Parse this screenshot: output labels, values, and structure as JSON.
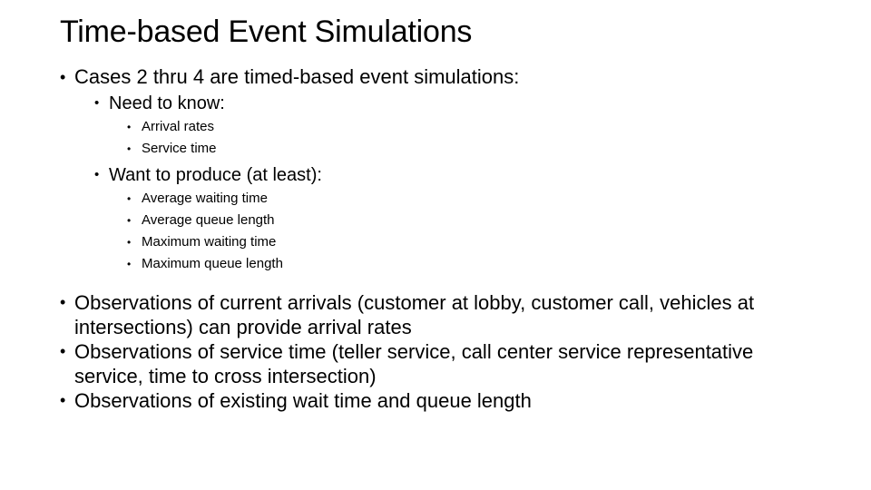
{
  "slide": {
    "title": "Time-based Event Simulations",
    "background_color": "#ffffff",
    "text_color": "#000000",
    "bullet_glyph": "•",
    "outline": {
      "level1_intro": "Cases 2 thru 4 are timed-based event simulations:",
      "level2_need": "Need to know:",
      "level3_need_items": [
        "Arrival rates",
        "Service time"
      ],
      "level2_want": "Want to produce (at least):",
      "level3_want_items": [
        "Average waiting time",
        "Average queue length",
        "Maximum waiting time",
        "Maximum queue length"
      ],
      "observations": [
        "Observations of current arrivals (customer at lobby, customer call, vehicles at intersections) can provide arrival rates",
        "Observations of service time (teller service, call center service representative service, time to cross intersection)",
        "Observations of existing wait time and queue length"
      ]
    }
  }
}
